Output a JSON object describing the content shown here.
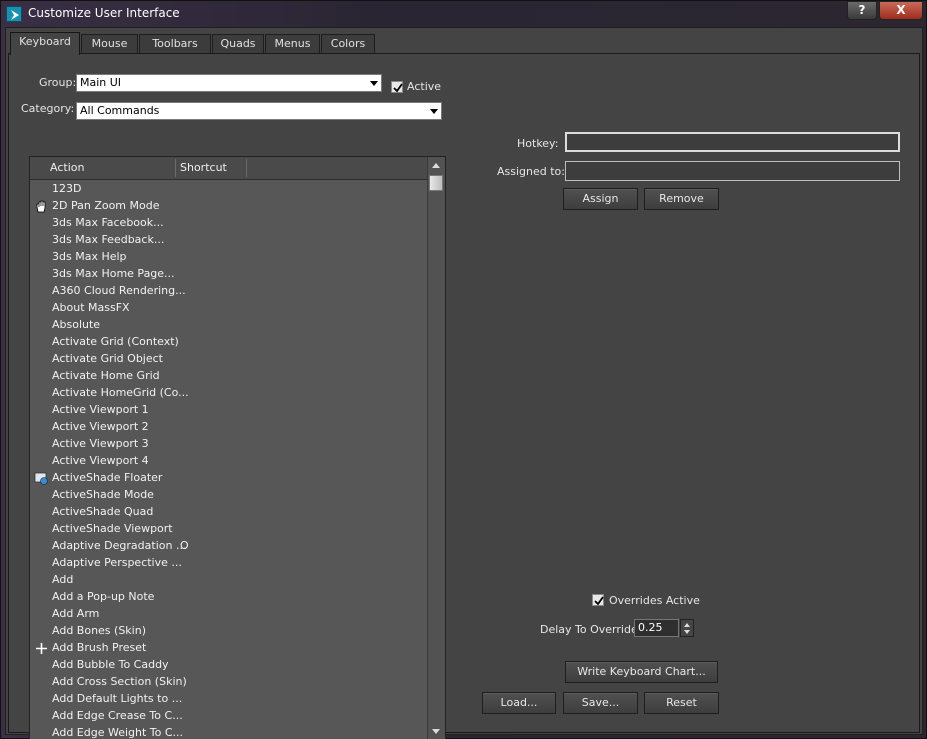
{
  "window": {
    "title": "Customize User Interface",
    "help_label": "?",
    "close_label": "X"
  },
  "tabs": [
    {
      "label": "Keyboard",
      "active": true
    },
    {
      "label": "Mouse"
    },
    {
      "label": "Toolbars"
    },
    {
      "label": "Quads"
    },
    {
      "label": "Menus"
    },
    {
      "label": "Colors"
    }
  ],
  "filters": {
    "group_label": "Group:",
    "group_value": "Main UI",
    "active_label": "Active",
    "active_checked": true,
    "category_label": "Category:",
    "category_value": "All Commands"
  },
  "action_list": {
    "columns": [
      "Action",
      "Shortcut"
    ],
    "rows": [
      {
        "action": "123D",
        "shortcut": "",
        "icon": ""
      },
      {
        "action": "2D Pan Zoom Mode",
        "shortcut": "",
        "icon": "hand-pan-icon"
      },
      {
        "action": "3ds Max Facebook...",
        "shortcut": "",
        "icon": ""
      },
      {
        "action": "3ds Max Feedback...",
        "shortcut": "",
        "icon": ""
      },
      {
        "action": "3ds Max Help",
        "shortcut": "",
        "icon": ""
      },
      {
        "action": "3ds Max Home Page...",
        "shortcut": "",
        "icon": ""
      },
      {
        "action": "A360 Cloud Rendering...",
        "shortcut": "",
        "icon": ""
      },
      {
        "action": "About MassFX",
        "shortcut": "",
        "icon": ""
      },
      {
        "action": "Absolute",
        "shortcut": "",
        "icon": ""
      },
      {
        "action": "Activate Grid (Context)",
        "shortcut": "",
        "icon": ""
      },
      {
        "action": "Activate Grid Object",
        "shortcut": "",
        "icon": ""
      },
      {
        "action": "Activate Home Grid",
        "shortcut": "",
        "icon": ""
      },
      {
        "action": "Activate HomeGrid (Co...",
        "shortcut": "",
        "icon": ""
      },
      {
        "action": "Active Viewport 1",
        "shortcut": "",
        "icon": ""
      },
      {
        "action": "Active Viewport 2",
        "shortcut": "",
        "icon": ""
      },
      {
        "action": "Active Viewport 3",
        "shortcut": "",
        "icon": ""
      },
      {
        "action": "Active Viewport 4",
        "shortcut": "",
        "icon": ""
      },
      {
        "action": "ActiveShade Floater",
        "shortcut": "",
        "icon": "activeshade-icon"
      },
      {
        "action": "ActiveShade Mode",
        "shortcut": "",
        "icon": ""
      },
      {
        "action": "ActiveShade Quad",
        "shortcut": "",
        "icon": ""
      },
      {
        "action": "ActiveShade Viewport",
        "shortcut": "",
        "icon": ""
      },
      {
        "action": "Adaptive Degradation ...",
        "shortcut": "O",
        "icon": ""
      },
      {
        "action": "Adaptive Perspective ...",
        "shortcut": "",
        "icon": ""
      },
      {
        "action": "Add",
        "shortcut": "",
        "icon": ""
      },
      {
        "action": "Add a Pop-up Note",
        "shortcut": "",
        "icon": ""
      },
      {
        "action": "Add Arm",
        "shortcut": "",
        "icon": ""
      },
      {
        "action": "Add Bones (Skin)",
        "shortcut": "",
        "icon": ""
      },
      {
        "action": "Add Brush Preset",
        "shortcut": "",
        "icon": "plus-icon"
      },
      {
        "action": "Add Bubble To Caddy",
        "shortcut": "",
        "icon": ""
      },
      {
        "action": "Add Cross Section (Skin)",
        "shortcut": "",
        "icon": ""
      },
      {
        "action": "Add Default Lights to ...",
        "shortcut": "",
        "icon": ""
      },
      {
        "action": "Add Edge Crease To C...",
        "shortcut": "",
        "icon": ""
      },
      {
        "action": "Add Edge Weight To C...",
        "shortcut": "",
        "icon": ""
      }
    ]
  },
  "hotkey_panel": {
    "hotkey_label": "Hotkey:",
    "hotkey_value": "",
    "assigned_label": "Assigned to:",
    "assigned_value": "",
    "assign_label": "Assign",
    "remove_label": "Remove"
  },
  "options": {
    "overrides_label": "Overrides Active",
    "overrides_checked": true,
    "delay_label": "Delay To Override:",
    "delay_value": "0.25"
  },
  "actions": {
    "write_chart_label": "Write Keyboard Chart...",
    "load_label": "Load...",
    "save_label": "Save...",
    "reset_label": "Reset"
  }
}
